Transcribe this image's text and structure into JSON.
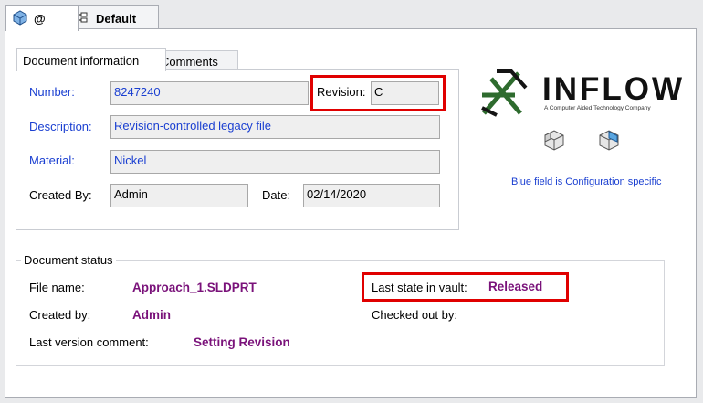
{
  "top_tabs": [
    {
      "label": "@",
      "icon": "part-icon"
    },
    {
      "label": "Default",
      "icon": "configuration-icon"
    }
  ],
  "inner_tabs": [
    "Document information",
    "Comments"
  ],
  "fields": {
    "number": {
      "label": "Number:",
      "value": "8247240"
    },
    "revision": {
      "label": "Revision:",
      "value": "C"
    },
    "description": {
      "label": "Description:",
      "value": "Revision-controlled legacy file"
    },
    "material": {
      "label": "Material:",
      "value": "Nickel"
    },
    "created_by": {
      "label": "Created By:",
      "value": "Admin"
    },
    "date": {
      "label": "Date:",
      "value": "02/14/2020"
    }
  },
  "logo": {
    "name": "INFLOW",
    "tagline": "A Computer Aided Technology Company"
  },
  "config_note": "Blue field is Configuration specific",
  "status": {
    "legend": "Document status",
    "file_name_label": "File name:",
    "file_name_value": "Approach_1.SLDPRT",
    "created_by_label": "Created by:",
    "created_by_value": "Admin",
    "comment_label": "Last version comment:",
    "comment_value": "Setting Revision",
    "state_label": "Last state in vault:",
    "state_value": "Released",
    "checked_out_label": "Checked out by:",
    "checked_out_value": ""
  },
  "colors": {
    "config_specific": "#1a3fd1",
    "status_value": "#7a127a",
    "highlight": "#e00000",
    "logo_green": "#2e6b2e"
  }
}
